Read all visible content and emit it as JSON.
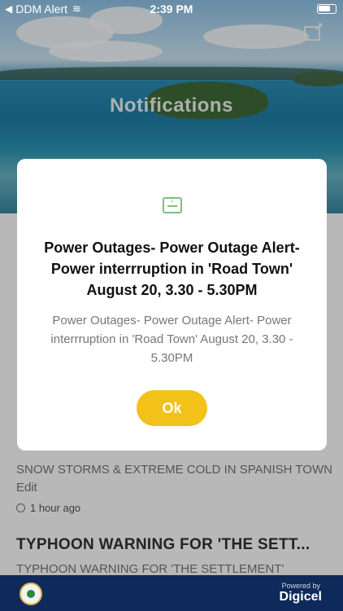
{
  "status_bar": {
    "back_app": "DDM Alert",
    "time": "2:39 PM"
  },
  "header": {
    "title": "Notifications",
    "share_icon": "share-icon"
  },
  "list_items": [
    {
      "description": "SNOW STORMS & EXTREME COLD IN SPANISH TOWN Edit",
      "time": "1 hour ago"
    },
    {
      "title": "TYPHOON WARNING FOR 'THE SETT...",
      "description": "TYPHOON WARNING FOR 'THE SETTLEMENT'"
    }
  ],
  "dialog": {
    "title": "Power Outages- Power Outage Alert- Power interrruption in 'Road Town' August 20, 3.30 - 5.30PM",
    "body": "Power Outages- Power Outage Alert- Power interrruption in 'Road Town' August 20, 3.30 - 5.30PM",
    "ok_label": "Ok",
    "icon": "inbox-download-icon",
    "ok_color": "#f2c21a"
  },
  "footer": {
    "powered_by": "Powered by",
    "brand": "Digicel",
    "background": "#0e2a5a"
  }
}
